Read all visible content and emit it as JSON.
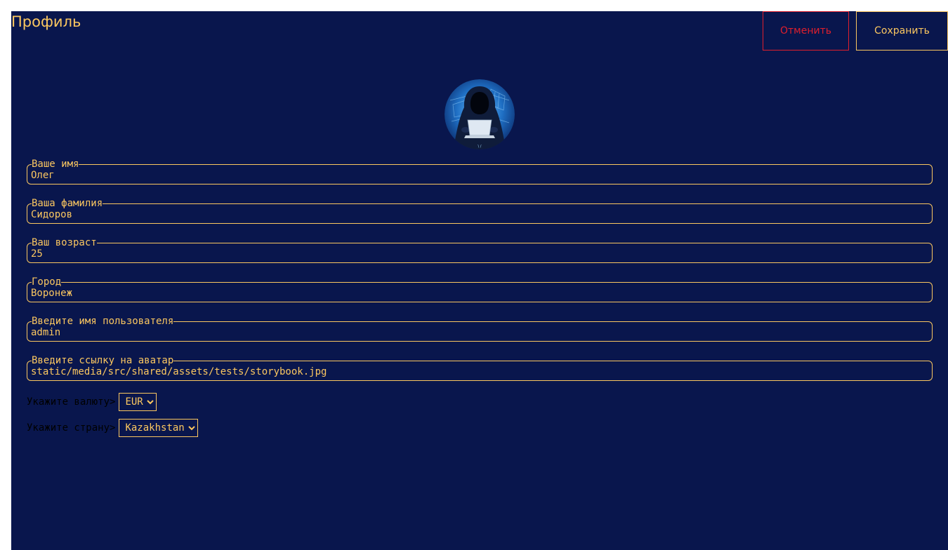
{
  "header": {
    "title": "Профиль",
    "cancel_label": "Отменить",
    "save_label": "Сохранить"
  },
  "colors": {
    "background": "#09164d",
    "accent": "#fbc760",
    "danger": "#e01f2c"
  },
  "avatar": {
    "icon": "hooded-hacker-with-laptop"
  },
  "form": {
    "first_name": {
      "label": "Ваше имя",
      "value": "Олег"
    },
    "last_name": {
      "label": "Ваша фамилия",
      "value": "Сидоров"
    },
    "age": {
      "label": "Ваш возраст",
      "value": "25"
    },
    "city": {
      "label": "Город",
      "value": "Воронеж"
    },
    "username": {
      "label": "Введите имя пользователя",
      "value": "admin"
    },
    "avatar_url": {
      "label": "Введите ссылку на аватар",
      "value": "static/media/src/shared/assets/tests/storybook.jpg"
    },
    "currency": {
      "label": "Укажите валюту>",
      "selected": "EUR"
    },
    "country": {
      "label": "Укажите страну>",
      "selected": "Kazakhstan"
    }
  }
}
